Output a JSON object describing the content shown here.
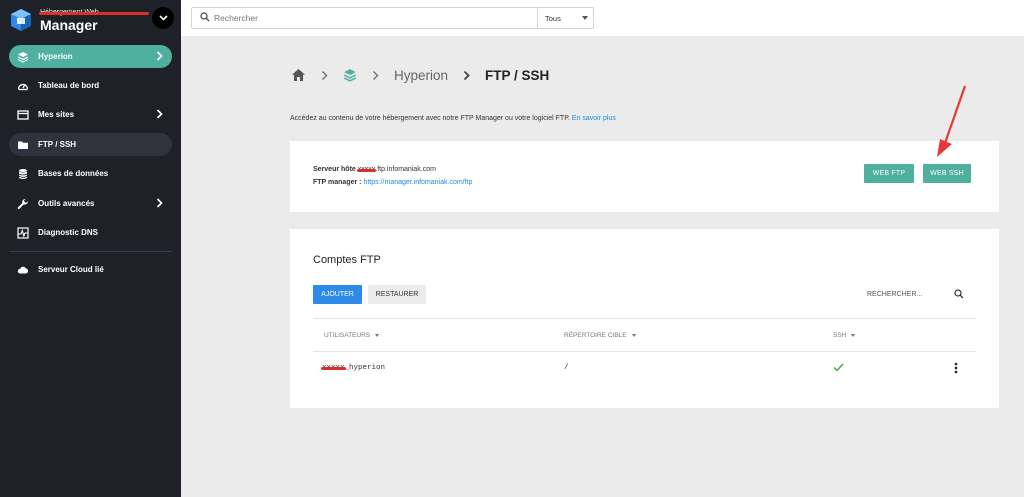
{
  "brand": {
    "subtitle": "Hébergement Web",
    "title": "Manager"
  },
  "sidebar": {
    "items": [
      {
        "label": "Hyperion",
        "icon": "stack-icon"
      },
      {
        "label": "Tableau de bord",
        "icon": "dashboard-icon"
      },
      {
        "label": "Mes sites",
        "icon": "browser-icon"
      },
      {
        "label": "FTP / SSH",
        "icon": "folder-icon"
      },
      {
        "label": "Bases de données",
        "icon": "database-icon"
      },
      {
        "label": "Outils avancés",
        "icon": "wrench-icon"
      },
      {
        "label": "Diagnostic DNS",
        "icon": "pulse-icon"
      },
      {
        "label": "Serveur Cloud lié",
        "icon": "cloud-icon"
      }
    ]
  },
  "topbar": {
    "search_placeholder": "Rechercher",
    "scope": "Tous"
  },
  "breadcrumb": {
    "items": [
      "Hyperion"
    ],
    "current": "FTP / SSH"
  },
  "intro": {
    "text": "Accédez au contenu de votre hébergement avec notre FTP Manager ou votre logiciel FTP.",
    "link": "En savoir plus"
  },
  "server": {
    "host_label": "Serveur hôte",
    "host_redacted": "xxxxx",
    "host_suffix": ".ftp.infomaniak.com",
    "manager_label": "FTP manager :",
    "manager_url": "https://manager.infomaniak.com/ftp",
    "web_ftp": "WEB FTP",
    "web_ssh": "WEB SSH"
  },
  "ftp": {
    "title": "Comptes FTP",
    "add": "AJOUTER",
    "restore": "RESTAURER",
    "search": "RECHERCHER...",
    "columns": [
      "UTILISATEURS",
      "RÉPERTOIRE CIBLE",
      "SSH"
    ],
    "rows": [
      {
        "user_redacted": "xxxxx",
        "user_suffix": "_hyperion",
        "dir": "/",
        "ssh": true
      }
    ]
  },
  "colors": {
    "accent": "#4fb0a0",
    "primary": "#2d8ae8",
    "sidebar": "#1e2128",
    "annotation": "#e53935"
  }
}
